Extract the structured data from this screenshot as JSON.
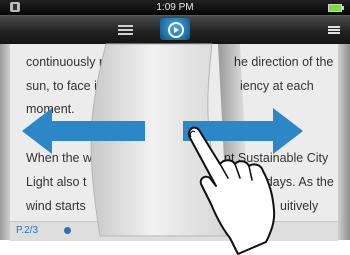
{
  "status_bar": {
    "time": "1:09 PM"
  },
  "toolbar": {
    "list_icon": "list-icon",
    "play_icon": "play-circle-icon",
    "menu_icon": "menu-icon"
  },
  "page": {
    "lines": [
      {
        "left": "continuously re",
        "right": "he direction of the"
      },
      {
        "left": "sun, to face it w",
        "right": "iency at each"
      },
      {
        "left": "moment.",
        "right": ""
      },
      {
        "left": "When the wi",
        "right": "nt Sustainable City"
      },
      {
        "left": "Light also t",
        "right": "y days. As the"
      },
      {
        "left": "wind starts",
        "right": "uitively"
      }
    ],
    "page_number": "P.2/3"
  },
  "colors": {
    "accent": "#2b87c6",
    "page_text": "#2a72b5"
  },
  "gesture": {
    "arrows": [
      "arrow-left",
      "arrow-right"
    ],
    "icon": "swipe-hand-icon"
  }
}
